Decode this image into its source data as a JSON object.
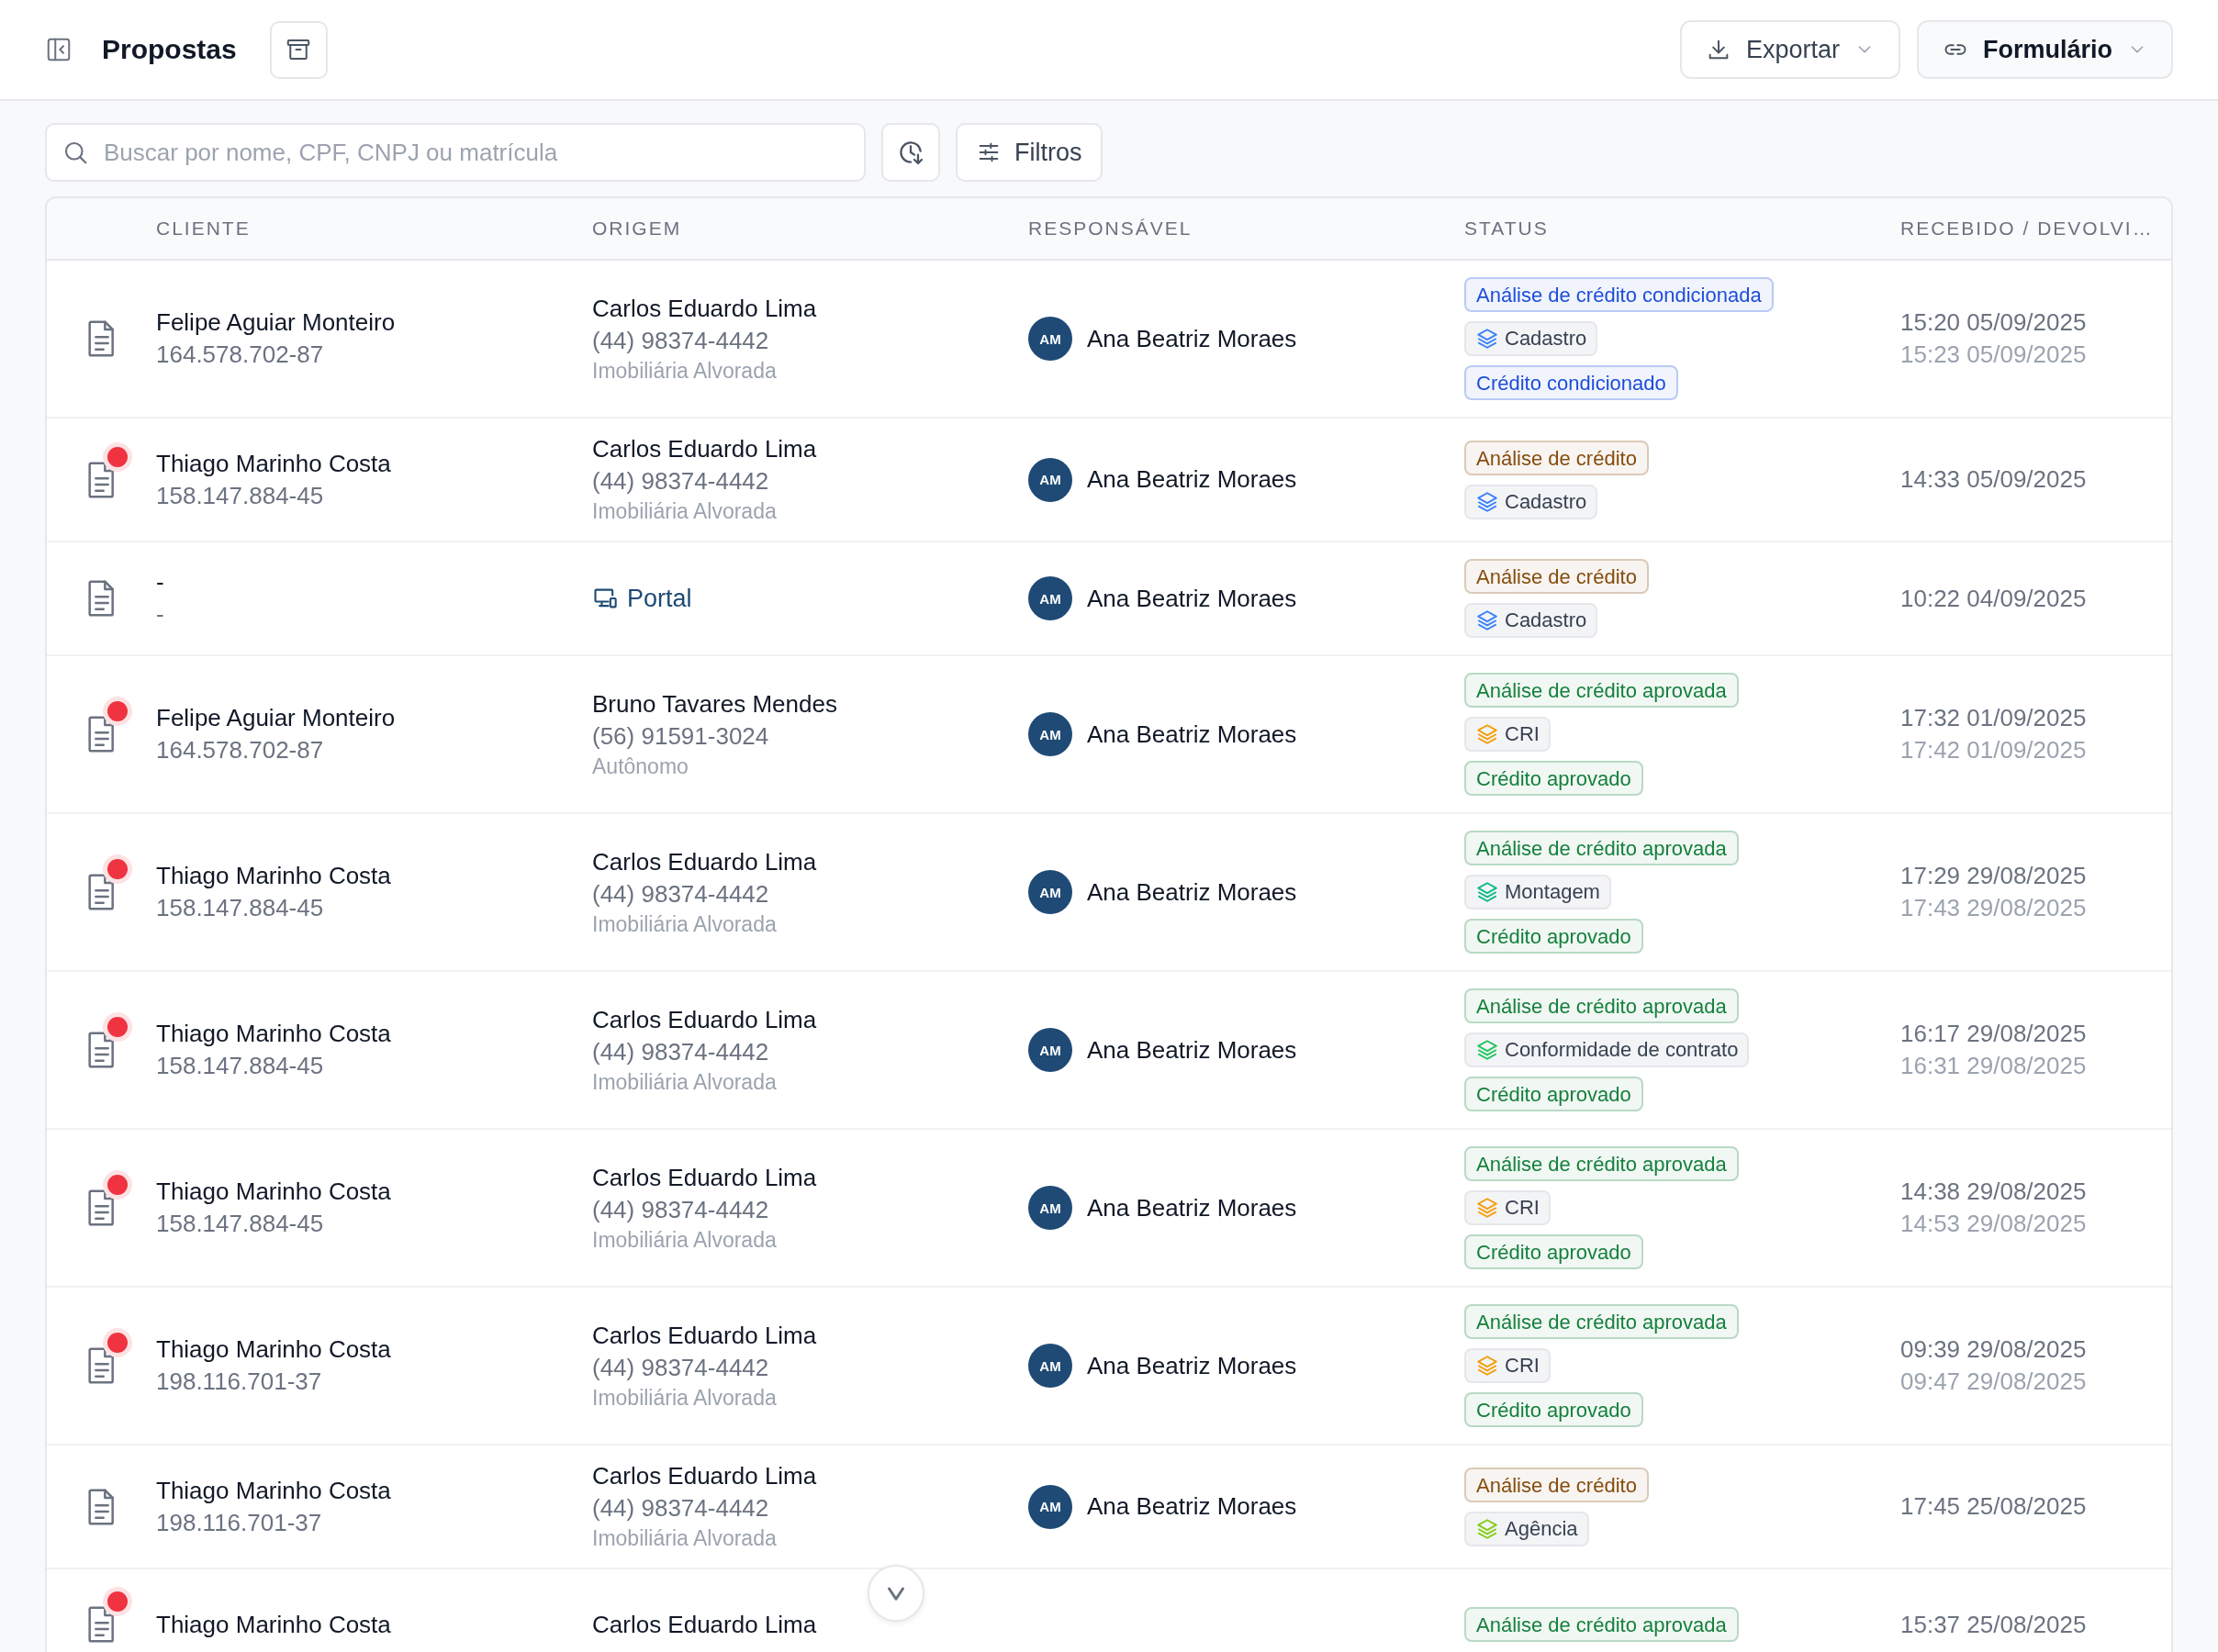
{
  "header": {
    "title": "Propostas",
    "buttons": [
      {
        "kind": "export",
        "label": "Exportar"
      },
      {
        "kind": "form",
        "label": "Formulário"
      }
    ]
  },
  "toolbar": {
    "search": {
      "placeholder": "Buscar por nome, CPF, CNPJ ou matrícula"
    },
    "filter_button": "Filtros"
  },
  "table": {
    "columns": [
      "CLIENTE",
      "ORIGEM",
      "RESPONSÁVEL",
      "STATUS",
      "RECEBIDO / DEVOLVI…"
    ],
    "rows": [
      {
        "unread": false,
        "client": {
          "name": "Felipe Aguiar Monteiro",
          "doc": "164.578.702-87"
        },
        "origin": {
          "kind": "person",
          "name": "Carlos Eduardo Lima",
          "phone": "(44) 98374-4442",
          "org": "Imobiliária Alvorada"
        },
        "assignee": {
          "initials": "AM",
          "name": "Ana Beatriz Moraes"
        },
        "statuses": [
          {
            "kind": "tag",
            "color": "#1d4ed8",
            "label": "Análise de crédito condicionada"
          },
          {
            "kind": "stage",
            "label": "Cadastro",
            "color": "#3b82f6"
          },
          {
            "kind": "tag",
            "color": "#1d4ed8",
            "label": "Crédito condicionado"
          }
        ],
        "received": "15:20 05/09/2025",
        "returned": "15:23 05/09/2025"
      },
      {
        "unread": true,
        "client": {
          "name": "Thiago Marinho Costa",
          "doc": "158.147.884-45"
        },
        "origin": {
          "kind": "person",
          "name": "Carlos Eduardo Lima",
          "phone": "(44) 98374-4442",
          "org": "Imobiliária Alvorada"
        },
        "assignee": {
          "initials": "AM",
          "name": "Ana Beatriz Moraes"
        },
        "statuses": [
          {
            "kind": "tag",
            "color": "#854d0e",
            "label": "Análise de crédito"
          },
          {
            "kind": "stage",
            "label": "Cadastro",
            "color": "#3b82f6"
          }
        ],
        "received": "14:33 05/09/2025"
      },
      {
        "unread": false,
        "client": {
          "name": "-",
          "doc": "-"
        },
        "origin": {
          "kind": "portal",
          "name": "Portal"
        },
        "assignee": {
          "initials": "AM",
          "name": "Ana Beatriz Moraes"
        },
        "statuses": [
          {
            "kind": "tag",
            "color": "#854d0e",
            "label": "Análise de crédito"
          },
          {
            "kind": "stage",
            "label": "Cadastro",
            "color": "#3b82f6"
          }
        ],
        "received": "10:22 04/09/2025"
      },
      {
        "unread": true,
        "client": {
          "name": "Felipe Aguiar Monteiro",
          "doc": "164.578.702-87"
        },
        "origin": {
          "kind": "person",
          "name": "Bruno Tavares Mendes",
          "phone": "(56) 91591-3024",
          "org": "Autônomo"
        },
        "assignee": {
          "initials": "AM",
          "name": "Ana Beatriz Moraes"
        },
        "statuses": [
          {
            "kind": "tag",
            "color": "#15803d",
            "label": "Análise de crédito aprovada"
          },
          {
            "kind": "stage",
            "label": "CRI",
            "color": "#f59e0b"
          },
          {
            "kind": "tag",
            "color": "#15803d",
            "label": "Crédito aprovado"
          }
        ],
        "received": "17:32 01/09/2025",
        "returned": "17:42 01/09/2025"
      },
      {
        "unread": true,
        "client": {
          "name": "Thiago Marinho Costa",
          "doc": "158.147.884-45"
        },
        "origin": {
          "kind": "person",
          "name": "Carlos Eduardo Lima",
          "phone": "(44) 98374-4442",
          "org": "Imobiliária Alvorada"
        },
        "assignee": {
          "initials": "AM",
          "name": "Ana Beatriz Moraes"
        },
        "statuses": [
          {
            "kind": "tag",
            "color": "#15803d",
            "label": "Análise de crédito aprovada"
          },
          {
            "kind": "stage",
            "label": "Montagem",
            "color": "#10b981"
          },
          {
            "kind": "tag",
            "color": "#15803d",
            "label": "Crédito aprovado"
          }
        ],
        "received": "17:29 29/08/2025",
        "returned": "17:43 29/08/2025"
      },
      {
        "unread": true,
        "client": {
          "name": "Thiago Marinho Costa",
          "doc": "158.147.884-45"
        },
        "origin": {
          "kind": "person",
          "name": "Carlos Eduardo Lima",
          "phone": "(44) 98374-4442",
          "org": "Imobiliária Alvorada"
        },
        "assignee": {
          "initials": "AM",
          "name": "Ana Beatriz Moraes"
        },
        "statuses": [
          {
            "kind": "tag",
            "color": "#15803d",
            "label": "Análise de crédito aprovada"
          },
          {
            "kind": "stage",
            "label": "Conformidade de contrato",
            "color": "#22c55e"
          },
          {
            "kind": "tag",
            "color": "#15803d",
            "label": "Crédito aprovado"
          }
        ],
        "received": "16:17 29/08/2025",
        "returned": "16:31 29/08/2025"
      },
      {
        "unread": true,
        "client": {
          "name": "Thiago Marinho Costa",
          "doc": "158.147.884-45"
        },
        "origin": {
          "kind": "person",
          "name": "Carlos Eduardo Lima",
          "phone": "(44) 98374-4442",
          "org": "Imobiliária Alvorada"
        },
        "assignee": {
          "initials": "AM",
          "name": "Ana Beatriz Moraes"
        },
        "statuses": [
          {
            "kind": "tag",
            "color": "#15803d",
            "label": "Análise de crédito aprovada"
          },
          {
            "kind": "stage",
            "label": "CRI",
            "color": "#f59e0b"
          },
          {
            "kind": "tag",
            "color": "#15803d",
            "label": "Crédito aprovado"
          }
        ],
        "received": "14:38 29/08/2025",
        "returned": "14:53 29/08/2025"
      },
      {
        "unread": true,
        "client": {
          "name": "Thiago Marinho Costa",
          "doc": "198.116.701-37"
        },
        "origin": {
          "kind": "person",
          "name": "Carlos Eduardo Lima",
          "phone": "(44) 98374-4442",
          "org": "Imobiliária Alvorada"
        },
        "assignee": {
          "initials": "AM",
          "name": "Ana Beatriz Moraes"
        },
        "statuses": [
          {
            "kind": "tag",
            "color": "#15803d",
            "label": "Análise de crédito aprovada"
          },
          {
            "kind": "stage",
            "label": "CRI",
            "color": "#f59e0b"
          },
          {
            "kind": "tag",
            "color": "#15803d",
            "label": "Crédito aprovado"
          }
        ],
        "received": "09:39 29/08/2025",
        "returned": "09:47 29/08/2025"
      },
      {
        "unread": false,
        "client": {
          "name": "Thiago Marinho Costa",
          "doc": "198.116.701-37"
        },
        "origin": {
          "kind": "person",
          "name": "Carlos Eduardo Lima",
          "phone": "(44) 98374-4442",
          "org": "Imobiliária Alvorada"
        },
        "assignee": {
          "initials": "AM",
          "name": "Ana Beatriz Moraes"
        },
        "statuses": [
          {
            "kind": "tag",
            "color": "#854d0e",
            "label": "Análise de crédito"
          },
          {
            "kind": "stage",
            "label": "Agência",
            "color": "#84cc16"
          }
        ],
        "received": "17:45 25/08/2025"
      },
      {
        "unread": true,
        "client": {
          "name": "Thiago Marinho Costa"
        },
        "origin": {
          "kind": "person",
          "name": "Carlos Eduardo Lima"
        },
        "statuses": [
          {
            "kind": "tag",
            "color": "#15803d",
            "label": "Análise de crédito aprovada"
          }
        ],
        "received": "15:37 25/08/2025"
      }
    ]
  }
}
